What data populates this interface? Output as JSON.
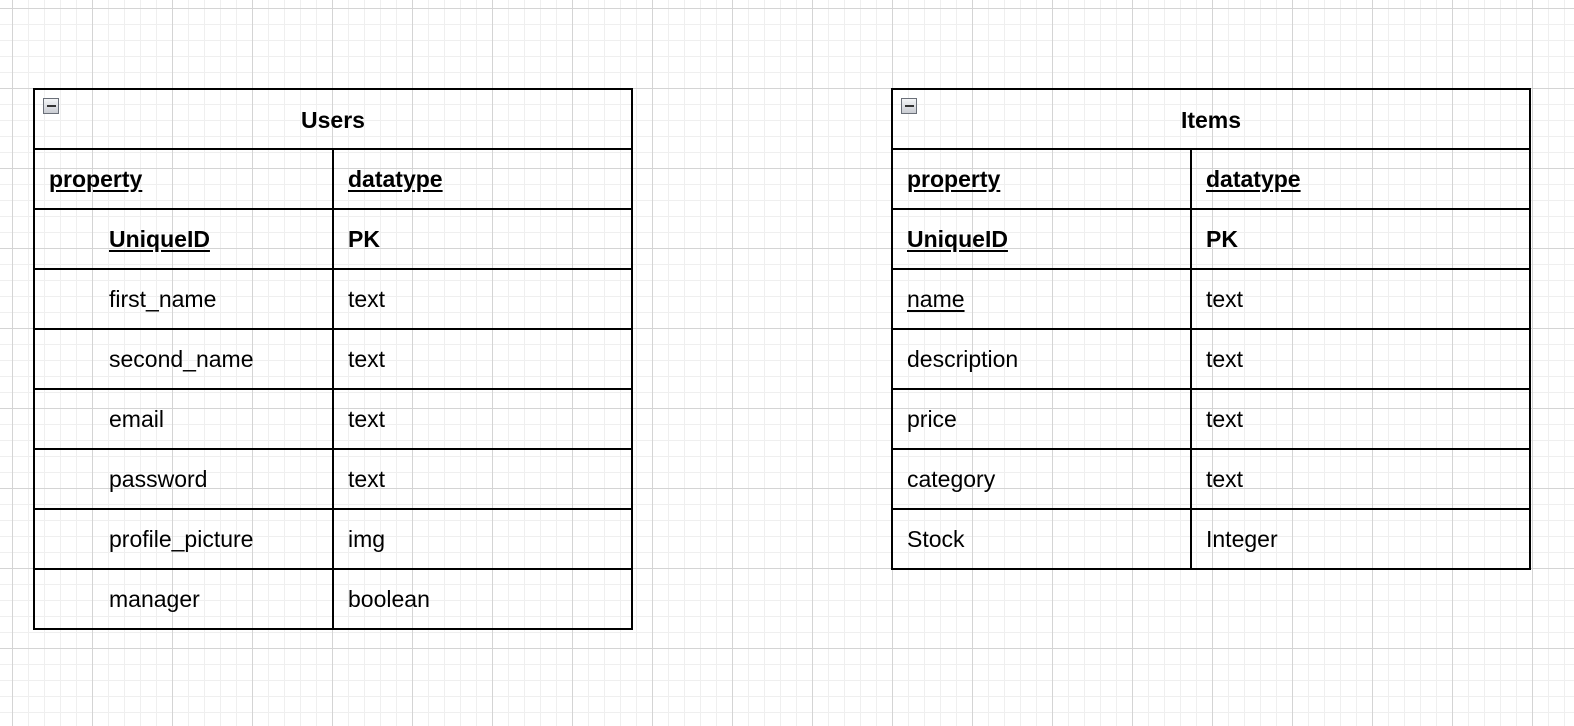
{
  "tables": [
    {
      "title": "Users",
      "header": {
        "property": "property",
        "datatype": "datatype"
      },
      "pk": {
        "property": "UniqueID",
        "datatype": "PK"
      },
      "rows": [
        {
          "property": "first_name",
          "datatype": "text"
        },
        {
          "property": "second_name",
          "datatype": "text"
        },
        {
          "property": "email",
          "datatype": "text"
        },
        {
          "property": "password",
          "datatype": "text"
        },
        {
          "property": "profile_picture",
          "datatype": "img"
        },
        {
          "property": "manager",
          "datatype": "boolean"
        }
      ]
    },
    {
      "title": "Items",
      "header": {
        "property": "property",
        "datatype": "datatype"
      },
      "pk": {
        "property": "UniqueID",
        "datatype": "PK"
      },
      "rows": [
        {
          "property": "name",
          "datatype": "text"
        },
        {
          "property": "description",
          "datatype": "text"
        },
        {
          "property": "price",
          "datatype": "text"
        },
        {
          "property": "category",
          "datatype": "text"
        },
        {
          "property": "Stock",
          "datatype": "Integer"
        }
      ]
    }
  ],
  "icons": {
    "collapse": "collapse-minus-icon"
  },
  "colors": {
    "border": "#000000",
    "grid_major": "#d4d4d4",
    "grid_minor": "#efefef"
  }
}
